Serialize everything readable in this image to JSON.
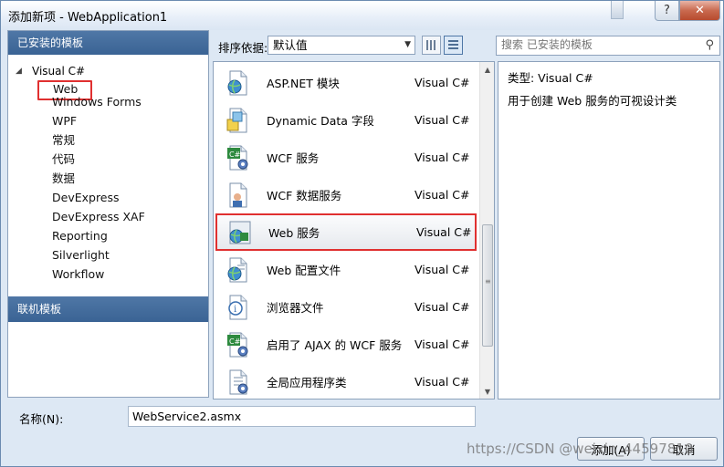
{
  "window": {
    "title": "添加新项 - WebApplication1"
  },
  "left_pane": {
    "installed_header": "已安装的模板",
    "tree_root": "Visual C#",
    "items": [
      "Web",
      "Windows Forms",
      "WPF",
      "常规",
      "代码",
      "数据",
      "DevExpress",
      "DevExpress XAF",
      "Reporting",
      "Silverlight",
      "Workflow"
    ],
    "online_header": "联机模板"
  },
  "toolbar": {
    "sort_label": "排序依据:",
    "sort_value": "默认值"
  },
  "search": {
    "placeholder": "搜索 已安装的模板"
  },
  "templates": [
    {
      "name": "ASP.NET 模块",
      "lang": "Visual C#",
      "icon": "globe-page-icon"
    },
    {
      "name": "Dynamic Data 字段",
      "lang": "Visual C#",
      "icon": "data-field-icon"
    },
    {
      "name": "WCF 服务",
      "lang": "Visual C#",
      "icon": "wcf-service-icon"
    },
    {
      "name": "WCF 数据服务",
      "lang": "Visual C#",
      "icon": "wcf-data-service-icon"
    },
    {
      "name": "Web 服务",
      "lang": "Visual C#",
      "icon": "web-service-icon"
    },
    {
      "name": "Web 配置文件",
      "lang": "Visual C#",
      "icon": "web-config-icon"
    },
    {
      "name": "浏览器文件",
      "lang": "Visual C#",
      "icon": "browser-file-icon"
    },
    {
      "name": "启用了 AJAX 的 WCF 服务",
      "lang": "Visual C#",
      "icon": "ajax-wcf-icon"
    },
    {
      "name": "全局应用程序类",
      "lang": "Visual C#",
      "icon": "global-class-icon"
    }
  ],
  "selected_template_index": 4,
  "details": {
    "type_line": "类型:  Visual C#",
    "description": "用于创建 Web 服务的可视设计类"
  },
  "footer": {
    "name_label": "名称(N):",
    "name_value": "WebService2.asmx",
    "add_button": "添加(A)",
    "cancel_button": "取消"
  },
  "watermark": "https://CSDN @weixin_44597810",
  "colors": {
    "header_blue": "#3a6394",
    "highlight_red": "#e03030",
    "dialog_bg": "#dde8f4"
  }
}
